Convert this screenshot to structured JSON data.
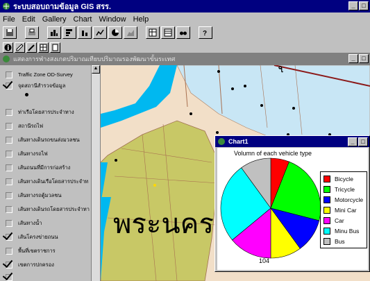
{
  "app": {
    "title": "ระบบสอบถามข้อมูล GIS สรร."
  },
  "menu": [
    "File",
    "Edit",
    "Gallery",
    "Chart",
    "Window",
    "Help"
  ],
  "document": {
    "title": "แสดงการฟ่างสงเกตปริมาณเทียบปริมาณรองพัฒนาขั้นระเทศ"
  },
  "layers": [
    {
      "label": "Traffic Zone OD-Survey",
      "checked": false
    },
    {
      "label": "จุดสถานีสำรวจข้อมูล",
      "checked": true
    },
    {
      "label": "ท่าเรือโดยสารประจำทาง",
      "checked": false
    },
    {
      "label": "สถานีรถไฟ",
      "checked": false
    },
    {
      "label": "เส้นทางเดินรถขนส่งมวลชน",
      "checked": false
    },
    {
      "label": "เส้นทางรถไฟ",
      "checked": false
    },
    {
      "label": "เส้นถนนที่มีการก่อสร้าง",
      "checked": false
    },
    {
      "label": "เส้นทางเดินเรือโดยสารประจำท",
      "checked": false
    },
    {
      "label": "เส้นทางรถตู้มวลชน",
      "checked": false
    },
    {
      "label": "เส้นทางเดินรถโดยสารประจำทา",
      "checked": false
    },
    {
      "label": "เส้นทางน้ำ",
      "checked": false
    },
    {
      "label": "เส้นโครงข่ายถนน",
      "checked": true
    },
    {
      "label": "พื้นที่เขตราชการ",
      "checked": false
    },
    {
      "label": "เขตการปกครอง",
      "checked": true
    }
  ],
  "map": {
    "district_label": "พระนคร"
  },
  "chart_window": {
    "title": "Chart1"
  },
  "chart_data": {
    "type": "pie",
    "title": "Volumn of each vehicle type",
    "footer": "104",
    "categories": [
      "Bicycle",
      "Tricycle",
      "Motorcycle",
      "Mini Car",
      "Car",
      "Minu Bus",
      "Bus"
    ],
    "values": [
      6,
      23,
      11,
      10,
      14,
      26,
      10
    ],
    "colors": [
      "#ff0000",
      "#00ff00",
      "#0000ff",
      "#ffff00",
      "#ff00ff",
      "#00ffff",
      "#c0c0c0"
    ]
  }
}
